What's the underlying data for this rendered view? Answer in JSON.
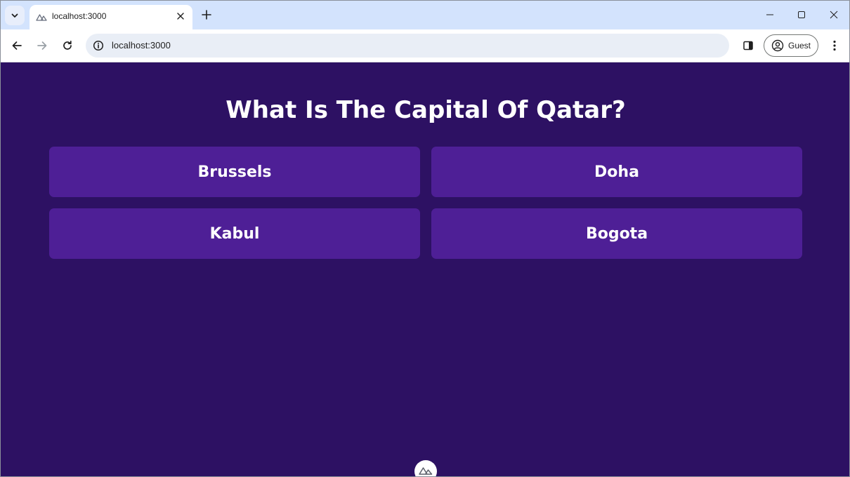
{
  "browser": {
    "tab": {
      "title": "localhost:3000",
      "favicon": "nuxt-logo-icon"
    },
    "address_bar": {
      "url": "localhost:3000"
    },
    "profile": {
      "label": "Guest"
    }
  },
  "quiz": {
    "question": "What Is The Capital Of Qatar?",
    "answers": [
      {
        "label": "Brussels"
      },
      {
        "label": "Doha"
      },
      {
        "label": "Kabul"
      },
      {
        "label": "Bogota"
      }
    ]
  },
  "colors": {
    "page_background": "#2d1163",
    "answer_background": "#4e1f96",
    "text": "#ffffff",
    "browser_frame": "#d3e3fd"
  }
}
